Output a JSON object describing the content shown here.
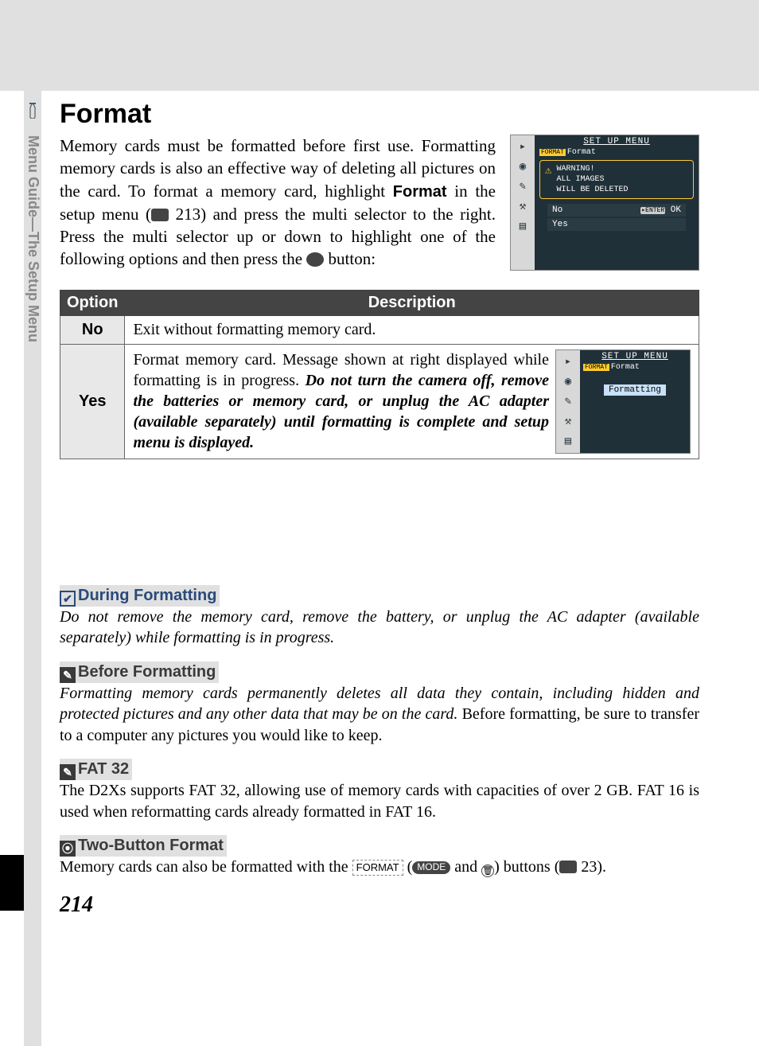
{
  "sidebar": {
    "label": "Menu Guide—The Setup Menu"
  },
  "heading": "Format",
  "intro": {
    "part1": "Memory cards must be formatted before first use.  Formatting memory cards is also an effective way of deleting all pictures on the card.  To format a memory card, highlight ",
    "bold1": "Format",
    "part2": " in the setup menu (",
    "pageref": "213",
    "part3": ") and press the multi selector to the right.  Press the multi selector up or down to highlight one of the following options and then press the ",
    "part4": " button:"
  },
  "lcd_main": {
    "title": "SET UP MENU",
    "sub": "Format",
    "warn_l1": "WARNING!",
    "warn_l2": "ALL IMAGES",
    "warn_l3": "WILL BE DELETED",
    "opt_no": "No",
    "opt_yes": "Yes",
    "ok": "OK"
  },
  "table": {
    "h_option": "Option",
    "h_desc": "Description",
    "rows": [
      {
        "option": "No",
        "desc": "Exit without formatting memory card."
      },
      {
        "option": "Yes",
        "desc_plain": "Format memory card.  Message shown at right displayed while formatting is in progress.  ",
        "desc_italic": "Do not turn the camera off, remove the batteries or memory card, or unplug the AC adapter (available separately) until formatting is complete and setup menu is displayed."
      }
    ]
  },
  "lcd_small": {
    "title": "SET UP MENU",
    "sub": "Format",
    "status": "Formatting"
  },
  "notes": {
    "during": {
      "title": "During Formatting",
      "body": "Do not remove the memory card, remove the battery, or unplug the AC adapter (available separately) while formatting is in progress."
    },
    "before": {
      "title": "Before Formatting",
      "body_italic": "Formatting memory cards permanently deletes all data they contain, including hidden and protected pictures and any other data that may be on the card. ",
      "body_plain": "Before formatting, be sure to transfer to a computer any pictures you would like to keep."
    },
    "fat32": {
      "title": "FAT 32",
      "body": "The D2Xs supports FAT 32, allowing use of memory cards with capacities of over 2 GB.  FAT 16 is used when reformatting cards already formatted in FAT 16."
    },
    "twobutton": {
      "title": "Two-Button Format",
      "part1": "Memory cards can also be formatted with the ",
      "btn1": "FORMAT",
      "mid1": " (",
      "btn2": "MODE",
      "mid2": " and ",
      "mid3": ") buttons (",
      "pageref": "23",
      "end": ")."
    }
  },
  "page_number": "214"
}
